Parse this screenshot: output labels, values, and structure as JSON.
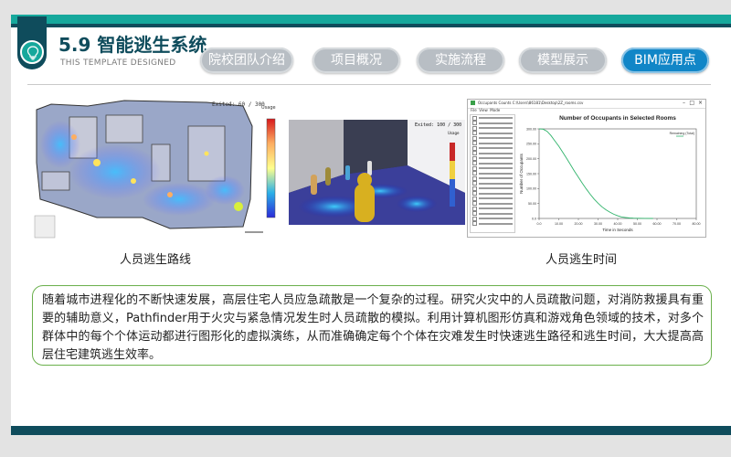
{
  "header": {
    "title": "5.9 智能逃生系统",
    "subtitle": "THIS TEMPLATE DESIGNED",
    "icon": "lightbulb-icon"
  },
  "nav": {
    "items": [
      {
        "label": "院校团队介绍",
        "active": false
      },
      {
        "label": "项目概况",
        "active": false
      },
      {
        "label": "实施流程",
        "active": false
      },
      {
        "label": "模型展示",
        "active": false
      },
      {
        "label": "BIM应用点",
        "active": true
      }
    ]
  },
  "images": {
    "left": {
      "caption": "人员逃生路线",
      "floor_plan_label": "Exited: 60 / 300",
      "floor_plan_legend_title": "Usage",
      "view3d_label": "Exited: 100 / 300",
      "view3d_legend_title": "Usage"
    },
    "right": {
      "caption": "人员逃生时间",
      "window_title": "Occupants Counts C:\\Users\\86181\\Desktop\\2Z_rooms.csv",
      "menu": [
        "File",
        "View",
        "Mode"
      ],
      "chart_title": "Number of Occupants in Selected Rooms",
      "legend_label": "Remaining (Total)"
    }
  },
  "chart_data": {
    "type": "line",
    "title": "Number of Occupants in Selected Rooms",
    "xlabel": "Time in Seconds",
    "ylabel": "Number of Occupants",
    "x_ticks": [
      "0.0",
      "10.00",
      "20.00",
      "30.00",
      "40.00",
      "50.00",
      "60.00",
      "70.00",
      "80.00"
    ],
    "y_ticks": [
      "0.0",
      "50.00",
      "100.00",
      "150.00",
      "200.00",
      "250.00",
      "300.00"
    ],
    "xlim": [
      0,
      80
    ],
    "ylim": [
      0,
      300
    ],
    "series": [
      {
        "name": "Remaining (Total)",
        "color": "#2fb36a",
        "x": [
          0,
          2,
          4,
          6,
          8,
          10,
          12,
          14,
          16,
          18,
          20,
          22,
          24,
          26,
          28,
          30,
          32,
          34,
          36,
          38,
          40,
          42,
          44,
          46,
          48,
          50,
          54,
          58
        ],
        "y": [
          300,
          299,
          292,
          278,
          260,
          242,
          222,
          201,
          180,
          158,
          138,
          118,
          99,
          81,
          65,
          51,
          39,
          29,
          21,
          14,
          9,
          5,
          3,
          1.5,
          1,
          0.5,
          0.2,
          0
        ]
      }
    ]
  },
  "body": {
    "text": "随着城市进程化的不断快速发展，高层住宅人员应急疏散是一个复杂的过程。研究火灾中的人员疏散问题，对消防救援具有重要的辅助意义，Pathfinder用于火灾与紧急情况发生时人员疏散的模拟。利用计算机图形仿真和游戏角色领域的技术，对多个群体中的每个个体运动都进行图形化的虚拟演练，从而准确确定每个个体在灾难发生时快速逃生路径和逃生时间，大大提高高层住宅建筑逃生效率。"
  },
  "colors": {
    "teal": "#16a89c",
    "navy": "#0f4c5c",
    "active_blue": "#1186c7",
    "inactive_gray": "#b8bec4",
    "frame_green": "#6ab04c"
  }
}
